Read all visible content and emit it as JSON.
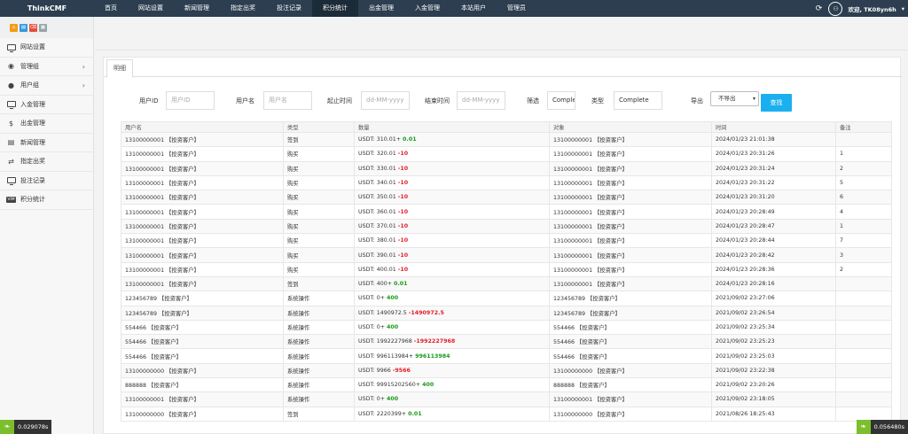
{
  "app": {
    "brand": "ThinkCMF"
  },
  "nav": [
    {
      "label": "首页",
      "active": false
    },
    {
      "label": "网站设置",
      "active": false
    },
    {
      "label": "新闻管理",
      "active": false
    },
    {
      "label": "指定出奖",
      "active": false
    },
    {
      "label": "投注记录",
      "active": false
    },
    {
      "label": "积分统计",
      "active": true
    },
    {
      "label": "出金管理",
      "active": false
    },
    {
      "label": "入金管理",
      "active": false
    },
    {
      "label": "本站用户",
      "active": false
    },
    {
      "label": "管理员",
      "active": false
    }
  ],
  "user": {
    "greeting": "欢迎, TK08yn6h"
  },
  "icons": {
    "refresh": "refresh-icon",
    "avatar": "avatar-icon",
    "dropdown": "caret-down-icon"
  },
  "shortcut_colors": [
    "#f39c12",
    "#3498db",
    "#e74c3c",
    "#95a5a6"
  ],
  "sidebar": [
    {
      "label": "网站设置",
      "icon": "monitor-icon",
      "chevron": false
    },
    {
      "label": "管理组",
      "icon": "user-circle-icon",
      "chevron": true
    },
    {
      "label": "用户组",
      "icon": "user-icon",
      "chevron": true
    },
    {
      "label": "入金管理",
      "icon": "monitor-icon",
      "chevron": false
    },
    {
      "label": "出金管理",
      "icon": "dollar-icon",
      "chevron": false
    },
    {
      "label": "新闻管理",
      "icon": "news-icon",
      "chevron": false
    },
    {
      "label": "指定出奖",
      "icon": "exchange-icon",
      "chevron": false
    },
    {
      "label": "投注记录",
      "icon": "monitor-icon",
      "chevron": false
    },
    {
      "label": "积分统计",
      "icon": "vimeo-icon",
      "chevron": false
    }
  ],
  "tab": {
    "label": "明细"
  },
  "filters": {
    "user_id_label": "用户ID",
    "user_id_placeholder": "用户ID",
    "username_label": "用户名",
    "username_placeholder": "用户名",
    "start_label": "起止时间",
    "start_placeholder": "dd-MM-yyyy",
    "end_label": "结束时间",
    "end_placeholder": "dd-MM-yyyy",
    "filter_label": "筛选",
    "filter_value": "Comple",
    "type_label": "类型",
    "type_value": "Complete",
    "export_label": "导出",
    "export_value": "不导出",
    "search_label": "查找"
  },
  "table": {
    "columns": [
      "用户名",
      "类型",
      "数量",
      "对象",
      "时间",
      "备注"
    ],
    "rows": [
      {
        "user": "13100000001 【投资客户】",
        "type": "签到",
        "base": "USDT: 310.01+ ",
        "delta": "0.01",
        "sign": "pos",
        "target": "13100000001 【投资客户】",
        "time": "2024/01/23 21:01:38",
        "note": ""
      },
      {
        "user": "13100000001 【投资客户】",
        "type": "购买",
        "base": "USDT: 320.01 ",
        "delta": "-10",
        "sign": "neg",
        "target": "13100000001 【投资客户】",
        "time": "2024/01/23 20:31:26",
        "note": "1"
      },
      {
        "user": "13100000001 【投资客户】",
        "type": "购买",
        "base": "USDT: 330.01 ",
        "delta": "-10",
        "sign": "neg",
        "target": "13100000001 【投资客户】",
        "time": "2024/01/23 20:31:24",
        "note": "2"
      },
      {
        "user": "13100000001 【投资客户】",
        "type": "购买",
        "base": "USDT: 340.01 ",
        "delta": "-10",
        "sign": "neg",
        "target": "13100000001 【投资客户】",
        "time": "2024/01/23 20:31:22",
        "note": "5"
      },
      {
        "user": "13100000001 【投资客户】",
        "type": "购买",
        "base": "USDT: 350.01 ",
        "delta": "-10",
        "sign": "neg",
        "target": "13100000001 【投资客户】",
        "time": "2024/01/23 20:31:20",
        "note": "6"
      },
      {
        "user": "13100000001 【投资客户】",
        "type": "购买",
        "base": "USDT: 360.01 ",
        "delta": "-10",
        "sign": "neg",
        "target": "13100000001 【投资客户】",
        "time": "2024/01/23 20:28:49",
        "note": "4"
      },
      {
        "user": "13100000001 【投资客户】",
        "type": "购买",
        "base": "USDT: 370.01 ",
        "delta": "-10",
        "sign": "neg",
        "target": "13100000001 【投资客户】",
        "time": "2024/01/23 20:28:47",
        "note": "1"
      },
      {
        "user": "13100000001 【投资客户】",
        "type": "购买",
        "base": "USDT: 380.01 ",
        "delta": "-10",
        "sign": "neg",
        "target": "13100000001 【投资客户】",
        "time": "2024/01/23 20:28:44",
        "note": "7"
      },
      {
        "user": "13100000001 【投资客户】",
        "type": "购买",
        "base": "USDT: 390.01 ",
        "delta": "-10",
        "sign": "neg",
        "target": "13100000001 【投资客户】",
        "time": "2024/01/23 20:28:42",
        "note": "3"
      },
      {
        "user": "13100000001 【投资客户】",
        "type": "购买",
        "base": "USDT: 400.01 ",
        "delta": "-10",
        "sign": "neg",
        "target": "13100000001 【投资客户】",
        "time": "2024/01/23 20:28:36",
        "note": "2"
      },
      {
        "user": "13100000001 【投资客户】",
        "type": "签到",
        "base": "USDT: 400+ ",
        "delta": "0.01",
        "sign": "pos",
        "target": "13100000001 【投资客户】",
        "time": "2024/01/23 20:28:16",
        "note": ""
      },
      {
        "user": "123456789 【投资客户】",
        "type": "系统操作",
        "base": "USDT: 0+ ",
        "delta": "400",
        "sign": "pos",
        "target": "123456789 【投资客户】",
        "time": "2021/09/02 23:27:06",
        "note": ""
      },
      {
        "user": "123456789 【投资客户】",
        "type": "系统操作",
        "base": "USDT: 1490972.5 ",
        "delta": "-1490972.5",
        "sign": "neg",
        "target": "123456789 【投资客户】",
        "time": "2021/09/02 23:26:54",
        "note": ""
      },
      {
        "user": "554466 【投资客户】",
        "type": "系统操作",
        "base": "USDT: 0+ ",
        "delta": "400",
        "sign": "pos",
        "target": "554466 【投资客户】",
        "time": "2021/09/02 23:25:34",
        "note": ""
      },
      {
        "user": "554466 【投资客户】",
        "type": "系统操作",
        "base": "USDT: 1992227968 ",
        "delta": "-1992227968",
        "sign": "neg",
        "target": "554466 【投资客户】",
        "time": "2021/09/02 23:25:23",
        "note": ""
      },
      {
        "user": "554466 【投资客户】",
        "type": "系统操作",
        "base": "USDT: 996113984+ ",
        "delta": "996113984",
        "sign": "pos",
        "target": "554466 【投资客户】",
        "time": "2021/09/02 23:25:03",
        "note": ""
      },
      {
        "user": "13100000000 【投资客户】",
        "type": "系统操作",
        "base": "USDT: 9966 ",
        "delta": "-9566",
        "sign": "neg",
        "target": "13100000000 【投资客户】",
        "time": "2021/09/02 23:22:38",
        "note": ""
      },
      {
        "user": "888888 【投资客户】",
        "type": "系统操作",
        "base": "USDT: 99915202560+ ",
        "delta": "400",
        "sign": "pos",
        "target": "888888 【投资客户】",
        "time": "2021/09/02 23:20:26",
        "note": ""
      },
      {
        "user": "13100000001 【投资客户】",
        "type": "系统操作",
        "base": "USDT: 0+ ",
        "delta": "400",
        "sign": "pos",
        "target": "13100000001 【投资客户】",
        "time": "2021/09/02 23:18:05",
        "note": ""
      },
      {
        "user": "13100000000 【投资客户】",
        "type": "签到",
        "base": "USDT: 2220399+ ",
        "delta": "0.01",
        "sign": "pos",
        "target": "13100000000 【投资客户】",
        "time": "2021/08/26 18:25:43",
        "note": ""
      }
    ]
  },
  "debug": {
    "left": "0.029078s",
    "right": "0.056480s"
  }
}
